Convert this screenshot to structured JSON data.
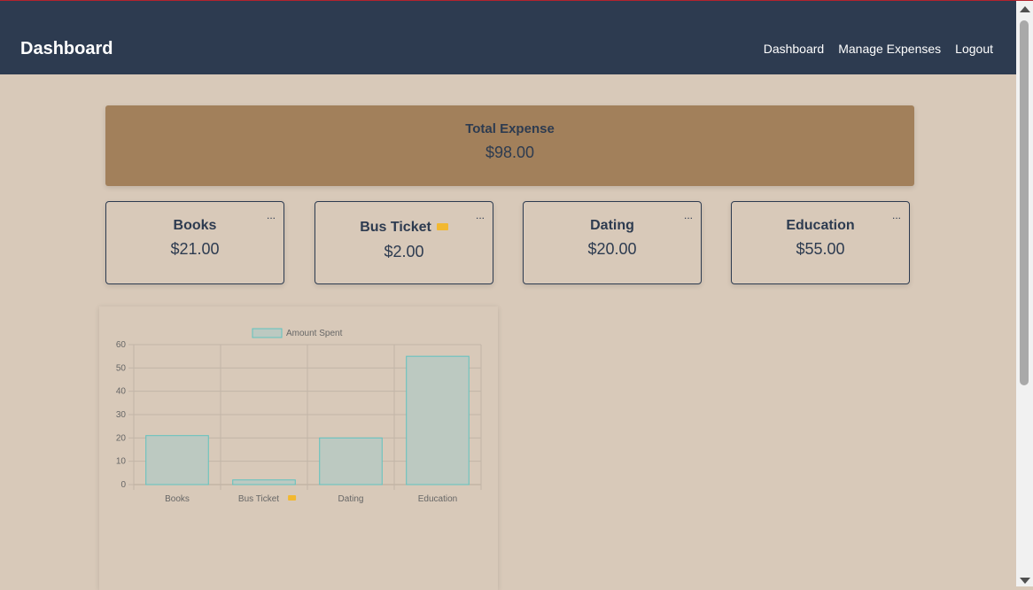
{
  "nav": {
    "brand": "Dashboard",
    "links": [
      "Dashboard",
      "Manage Expenses",
      "Logout"
    ]
  },
  "summary": {
    "label": "Total Expense",
    "value": "$98.00"
  },
  "categories": [
    {
      "name": "Books",
      "amount": "$21.00",
      "menu": "...",
      "icon": ""
    },
    {
      "name": "Bus Ticket",
      "amount": "$2.00",
      "menu": "...",
      "icon": "ticket-icon"
    },
    {
      "name": "Dating",
      "amount": "$20.00",
      "menu": "...",
      "icon": ""
    },
    {
      "name": "Education",
      "amount": "$55.00",
      "menu": "...",
      "icon": ""
    }
  ],
  "colors": {
    "navbar": "#2d3b50",
    "background": "#d8c9b9",
    "summary_card": "#a2805b",
    "bar_fill": "#bcc9c1",
    "bar_stroke": "#5fc2c0"
  },
  "chart_data": {
    "type": "bar",
    "categories": [
      "Books",
      "Bus Ticket",
      "Dating",
      "Education"
    ],
    "series": [
      {
        "name": "Amount Spent",
        "values": [
          21,
          2,
          20,
          55
        ]
      }
    ],
    "ylim": [
      0,
      60
    ],
    "yticks": [
      0,
      10,
      20,
      30,
      40,
      50,
      60
    ],
    "legend": "top",
    "grid": true
  }
}
